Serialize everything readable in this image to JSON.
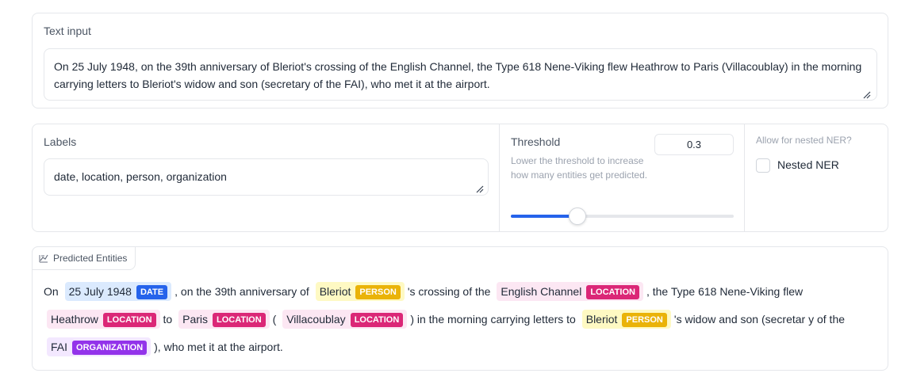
{
  "text_input": {
    "label": "Text input",
    "value": "On 25 July 1948, on the 39th anniversary of Bleriot's crossing of the English Channel, the Type 618 Nene-Viking flew Heathrow to Paris (Villacoublay) in the morning carrying letters to Bleriot's widow and son (secretary of the FAI), who met it at the airport."
  },
  "labels_field": {
    "label": "Labels",
    "value": "date, location, person, organization"
  },
  "threshold": {
    "label": "Threshold",
    "info": "Lower the threshold to increase how many entities get predicted.",
    "value": "0.3",
    "slider_fraction": 0.3
  },
  "nested": {
    "info": "Allow for nested NER?",
    "checkbox_label": "Nested NER",
    "checked": false
  },
  "predicted": {
    "tab_label": "Predicted Entities",
    "segments": [
      {
        "text": "On",
        "entity": null
      },
      {
        "text": "25 July 1948",
        "entity": "DATE"
      },
      {
        "text": ", on the 39th anniversary of",
        "entity": null
      },
      {
        "text": "Bleriot",
        "entity": "PERSON"
      },
      {
        "text": "'s crossing of the",
        "entity": null
      },
      {
        "text": "English Channel",
        "entity": "LOCATION"
      },
      {
        "text": ", the Type 618 Nene-Viking flew",
        "entity": null
      },
      {
        "text": "Heathrow",
        "entity": "LOCATION"
      },
      {
        "text": "to",
        "entity": null
      },
      {
        "text": "Paris",
        "entity": "LOCATION"
      },
      {
        "text": "(",
        "entity": null
      },
      {
        "text": "Villacoublay",
        "entity": "LOCATION"
      },
      {
        "text": ") in the morning carrying letters to",
        "entity": null
      },
      {
        "text": "Bleriot",
        "entity": "PERSON"
      },
      {
        "text": "'s widow and son (secretar",
        "entity": null
      },
      {
        "text": "y of the",
        "entity": null
      },
      {
        "text": "FAI",
        "entity": "ORGANIZATION"
      },
      {
        "text": "), who met it at the airport.",
        "entity": null
      }
    ]
  },
  "colors": {
    "DATE": "#2563eb",
    "PERSON": "#eab308",
    "LOCATION": "#db2777",
    "ORGANIZATION": "#9333ea",
    "accent": "#2563eb"
  },
  "icons": {
    "entities_tab": "chart-icon",
    "textarea_grip": "resize-grip-icon"
  }
}
